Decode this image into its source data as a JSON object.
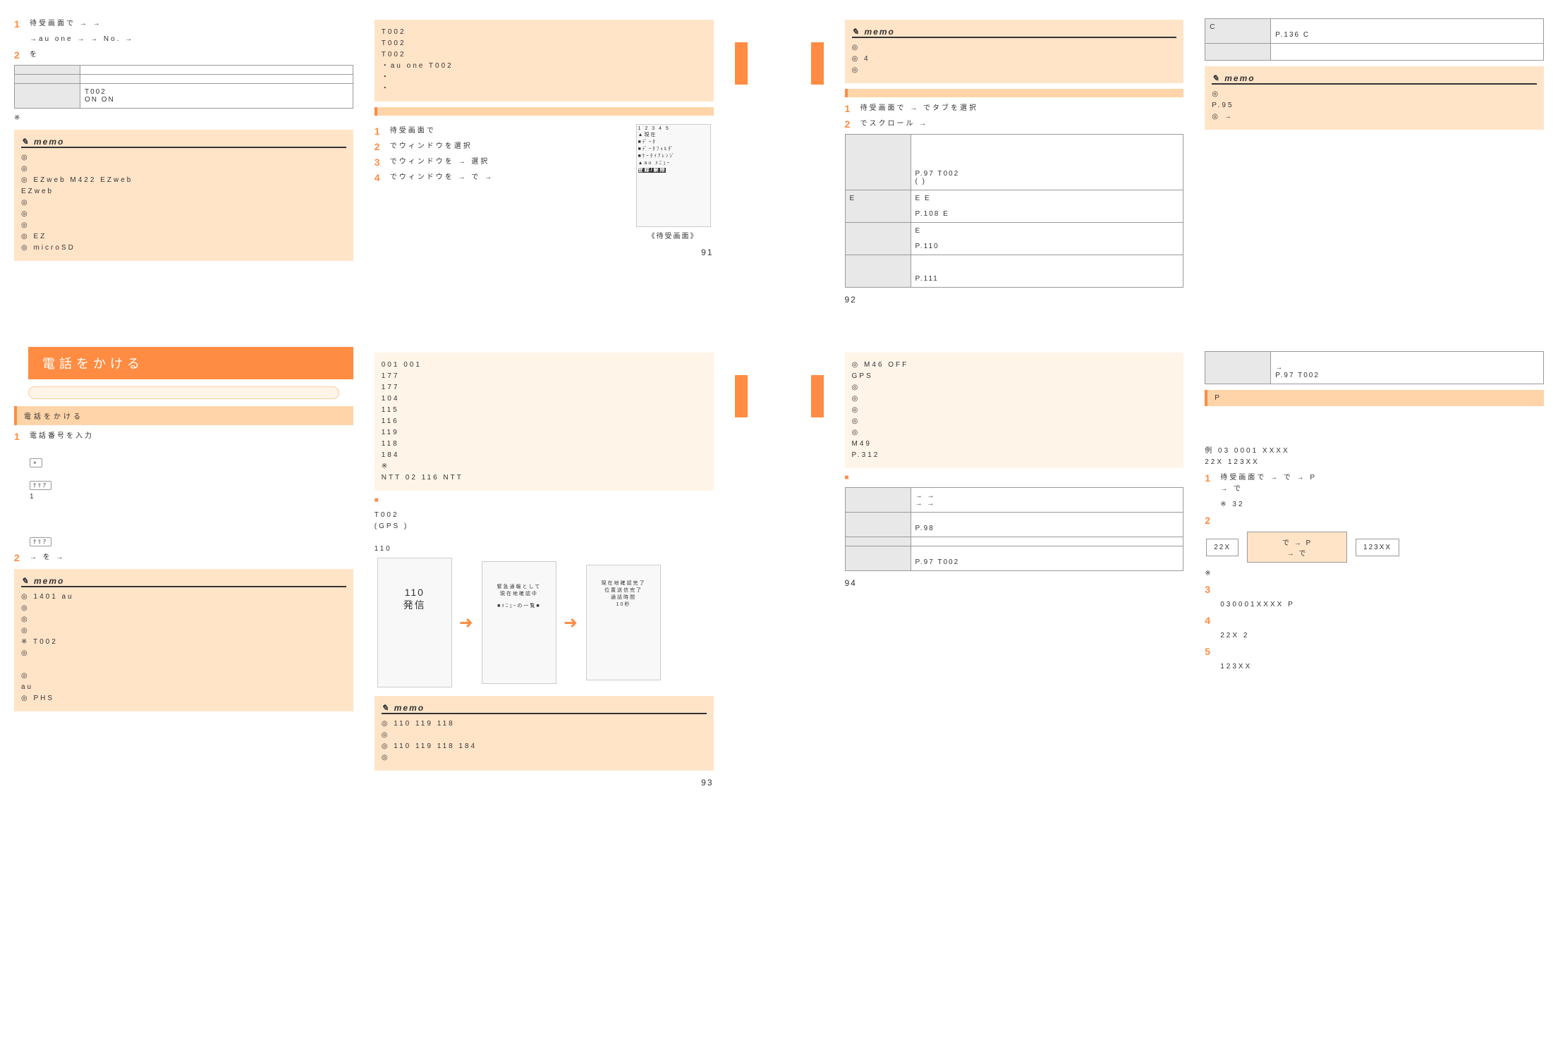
{
  "p91": {
    "step1": "待受画面で → →",
    "step1b": "→au one → → No. →",
    "step2": "を",
    "tbl": [
      [
        "",
        ""
      ],
      [
        "",
        ""
      ],
      [
        "",
        "T002\nON ON"
      ]
    ],
    "note": "※",
    "memo_lines": [
      "◎",
      "◎",
      "◎ EZweb M422 EZweb\n  EZweb",
      "◎",
      "◎",
      "◎",
      "◎ EZ",
      "◎ microSD"
    ],
    "right_txt": " T002\n T002\n T002\n・au one T002\n・\n・",
    "section": "",
    "r_txt2": "",
    "rs1": "待受画面で",
    "rs2": "でウィンドウを選択",
    "rs3": "でウィンドウを → 選択",
    "rs4": "でウィンドウを → で →",
    "caption": "《待受画面》",
    "page": "91"
  },
  "p92": {
    "memo_lines": [
      "◎",
      "◎ 4\n",
      "◎"
    ],
    "section": "",
    "txt": "",
    "s1": "待受画面で → でタブを選択",
    "s2": "でスクロール →",
    "tbl": [
      [
        "",
        " \n\n\n\nP.97 T002\n( )"
      ],
      [
        "E",
        "E E\n\nP.108 E"
      ],
      [
        "",
        "E\n\nP.110"
      ],
      [
        "",
        "\n\nP.111"
      ]
    ],
    "right_tbl": [
      [
        "C",
        "\nP.136 C"
      ],
      [
        "",
        "\n"
      ]
    ],
    "right_memo": [
      "◎ \nP.95",
      "◎ →"
    ],
    "page": "92"
  },
  "p93": {
    "header": "電話をかける",
    "sub": "",
    "section": "電話をかける",
    "s1": "電話番号を入力",
    "s1_txt": "\n1\n\n",
    "s2": "→ を →",
    "s2_txt": "",
    "memo": [
      "◎ 1401 au",
      "◎",
      "◎",
      "◎\n",
      "※ T002",
      "◎ \n\n",
      "◎\nau",
      "◎ PHS"
    ],
    "r_list": [
      " 001 001",
      " 177",
      " 177",
      " 104",
      " 115",
      " 116",
      " 119",
      " 118",
      " 184",
      " ※",
      "  NTT 02 116 NTT"
    ],
    "sm_title": "",
    "r_txt": "T002\n(GPS )\n\n 110",
    "screens": [
      "110\n発信",
      "緊急通報として\n現在地確認中\n\n■ﾒﾆｭｰの一覧■",
      "現在地確認完了\n位置送信完了\n通話時間\n10秒"
    ],
    "r_memo": [
      "◎ 110 119 118",
      "◎",
      "◎ 110 119 118 184",
      "◎"
    ],
    "page": "93"
  },
  "p94": {
    "memo": [
      "◎ M46 OFF",
      "GPS",
      "◎",
      "◎",
      "◎",
      "◎",
      "◎",
      " M49\nP.312"
    ],
    "sm_title": "",
    "txt": "",
    "tbl": [
      [
        "",
        " → →\n→ →"
      ],
      [
        "",
        "\nP.98"
      ],
      [
        "",
        ""
      ],
      [
        "",
        "\nP.97 T002"
      ]
    ],
    "r_tbl": [
      [
        "",
        "\n→\nP.97 T002"
      ]
    ],
    "r_section": "P",
    "r_txt": "\n\n\n例 03 0001 XXXX\n   22X 123XX",
    "rs1": "待受画面で → で → P\n→ で",
    "rs1_note": "※ 32",
    "rs2": "",
    "box1_h": "",
    "box1": "22X",
    "box2_h": "",
    "box2": "で → P\n→ で",
    "box3_h": "",
    "box3": "123XX",
    "box_note": "※",
    "rs3": "",
    "rs3_txt": " 030001XXXX P",
    "rs4": "",
    "rs4_txt": " 22X 2",
    "rs5": "",
    "rs5_txt": " 123XX",
    "page": "94"
  }
}
